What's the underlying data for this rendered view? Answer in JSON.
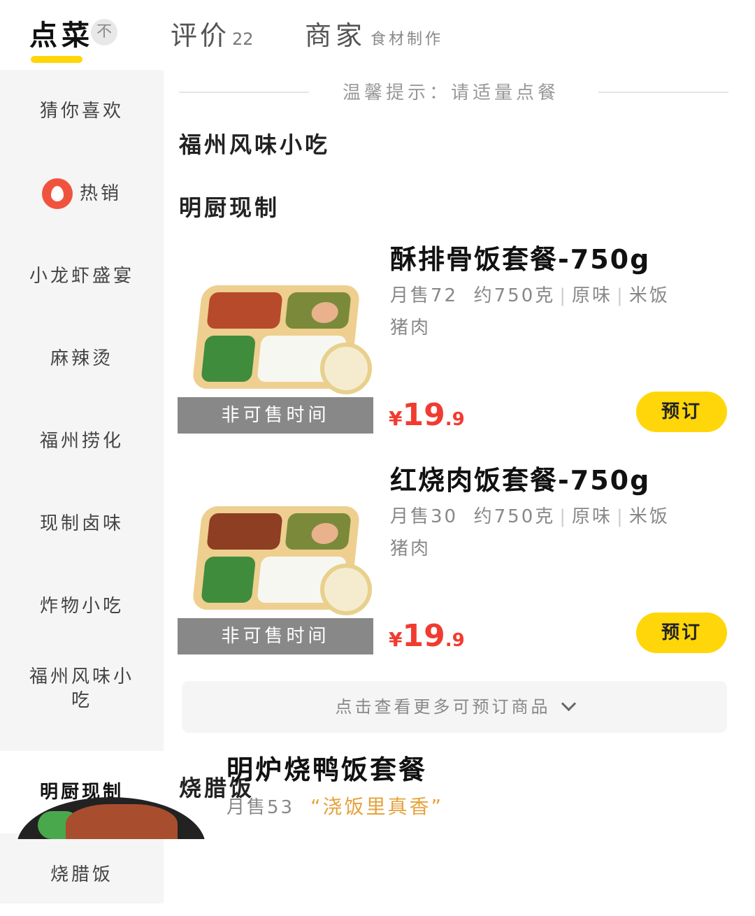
{
  "tabs": {
    "order": "点菜",
    "no_tag": "不",
    "review": "评价",
    "review_count": "22",
    "merchant": "商家",
    "merchant_note": "食材制作"
  },
  "sidebar": {
    "items": [
      {
        "label": "猜你喜欢"
      },
      {
        "label": "热销"
      },
      {
        "label": "小龙虾盛宴"
      },
      {
        "label": "麻辣烫"
      },
      {
        "label": "福州捞化"
      },
      {
        "label": "现制卤味"
      },
      {
        "label": "炸物小吃"
      },
      {
        "label": "福州风味小吃"
      },
      {
        "label": "明厨现制"
      },
      {
        "label": "烧腊饭"
      }
    ],
    "active_index": 8
  },
  "main": {
    "tip": "温馨提示：请适量点餐",
    "sections": [
      "福州风味小吃",
      "明厨现制",
      "烧腊饭"
    ],
    "products": [
      {
        "name": "酥排骨饭套餐-750g",
        "monthly_sales": "月售72",
        "weight": "约750克",
        "flavor": "原味",
        "staple": "米饭",
        "meat": "猪肉",
        "unavailable": "非可售时间",
        "currency": "¥",
        "price_int": "19",
        "price_dec": ".9",
        "button": "预订"
      },
      {
        "name": "红烧肉饭套餐-750g",
        "monthly_sales": "月售30",
        "weight": "约750克",
        "flavor": "原味",
        "staple": "米饭",
        "meat": "猪肉",
        "unavailable": "非可售时间",
        "currency": "¥",
        "price_int": "19",
        "price_dec": ".9",
        "button": "预订"
      }
    ],
    "more": "点击查看更多可预订商品",
    "roast": {
      "name": "明炉烧鸭饭套餐",
      "monthly_sales": "月售53",
      "slogan": "“浇饭里真香”"
    }
  },
  "colors": {
    "accent": "#ffd60a",
    "price": "#f23b30",
    "sidebar_bg": "#f5f5f5",
    "slogan": "#e6a23c"
  }
}
